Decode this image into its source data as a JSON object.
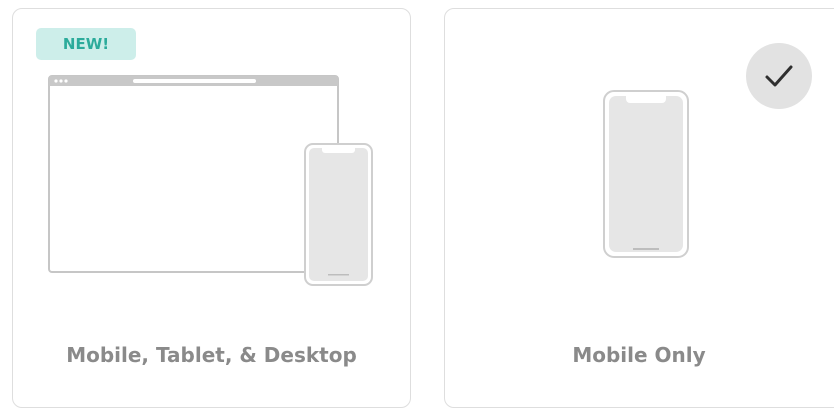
{
  "options": [
    {
      "label": "Mobile, Tablet, & Desktop",
      "badge": "NEW!",
      "selected": false
    },
    {
      "label": "Mobile Only",
      "selected": true
    }
  ],
  "icons": {
    "selected_indicator": "checkmark-icon",
    "left_illustration": "desktop-and-phone-icon",
    "right_illustration": "phone-icon"
  },
  "colors": {
    "badge_background": "#cdeeea",
    "badge_text": "#2bab9b",
    "label_text": "#8a8a8a",
    "card_border": "#dedede",
    "check_background": "#e2e2e2"
  }
}
